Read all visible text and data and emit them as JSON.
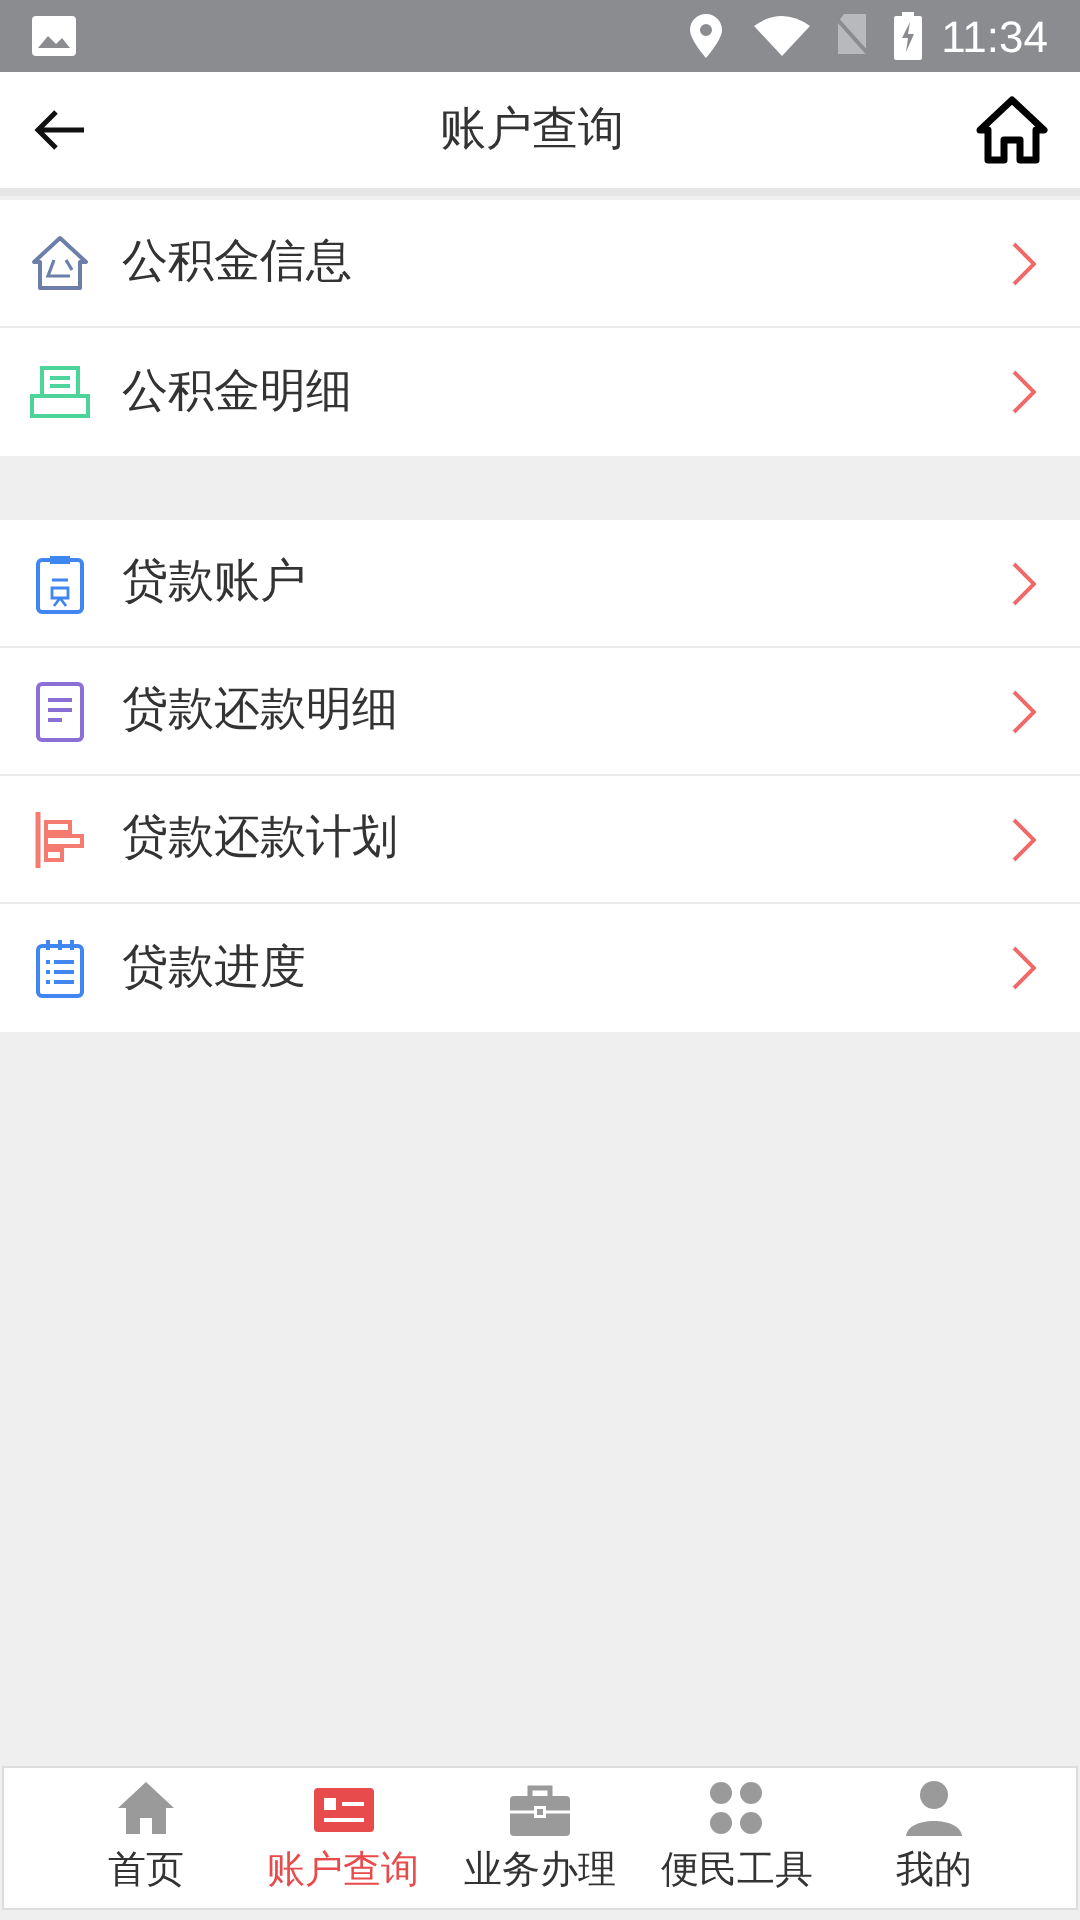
{
  "status_bar": {
    "time": "11:34"
  },
  "header": {
    "title": "账户查询"
  },
  "groups": [
    {
      "items": [
        {
          "label": "公积金信息"
        },
        {
          "label": "公积金明细"
        }
      ]
    },
    {
      "items": [
        {
          "label": "贷款账户"
        },
        {
          "label": "贷款还款明细"
        },
        {
          "label": "贷款还款计划"
        },
        {
          "label": "贷款进度"
        }
      ]
    }
  ],
  "tabs": [
    {
      "label": "首页",
      "selected": false
    },
    {
      "label": "账户查询",
      "selected": true
    },
    {
      "label": "业务办理",
      "selected": false
    },
    {
      "label": "便民工具",
      "selected": false
    },
    {
      "label": "我的",
      "selected": false
    }
  ]
}
